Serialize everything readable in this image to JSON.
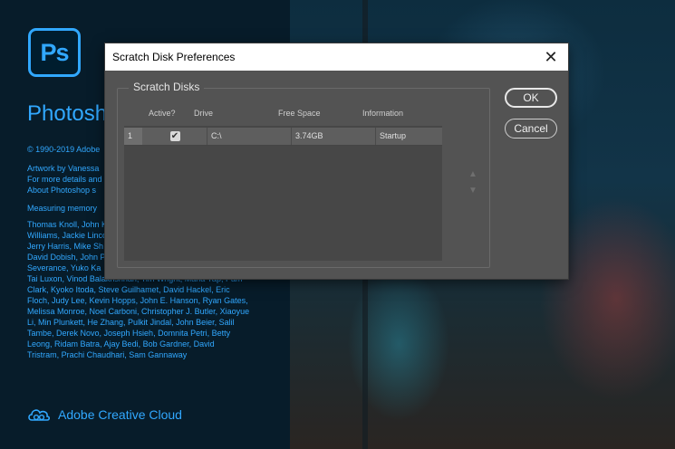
{
  "splash": {
    "logo_text": "Ps",
    "app_name": "Photoshop",
    "copyright": "© 1990-2019 Adobe",
    "artwork_lines": [
      "Artwork by Vanessa",
      "For more details and",
      "About Photoshop s"
    ],
    "measuring": "Measuring memory",
    "credits_top_lines": [
      "Thomas Knoll, John K",
      "Williams, Jackie Linco",
      "Jerry Harris, Mike Sh",
      "David Dobish, John P",
      "Severance, Yuko Ka"
    ],
    "credits_bottom_lines": [
      "Tai Luxon, Vinod Balakrishnan, Tim Wright, Maria Yap, Pam",
      "Clark, Kyoko Itoda, Steve Guilhamet, David Hackel, Eric",
      "Floch, Judy Lee, Kevin Hopps, John E. Hanson, Ryan Gates,",
      "Melissa Monroe, Noel Carboni, Christopher J. Butler, Xiaoyue",
      "Li, Min Plunkett, He Zhang, Pulkit Jindal, John Beier, Salil",
      "Tambe, Derek Novo, Joseph Hsieh, Domnita Petri, Betty",
      "Leong, Ridam Batra, Ajay Bedi, Bob Gardner, David",
      "Tristram, Prachi Chaudhari, Sam Gannaway"
    ],
    "cc_label": "Adobe Creative Cloud"
  },
  "dialog": {
    "title": "Scratch Disk Preferences",
    "close_glyph": "✕",
    "group_title": "Scratch Disks",
    "columns": {
      "active": "Active?",
      "drive": "Drive",
      "free_space": "Free Space",
      "information": "Information"
    },
    "rows": [
      {
        "num": "1",
        "active": true,
        "drive": "C:\\",
        "free_space": "3.74GB",
        "information": "Startup"
      }
    ],
    "check_glyph": "✔",
    "up_arrow": "▲",
    "down_arrow": "▼",
    "ok_label": "OK",
    "cancel_label": "Cancel"
  },
  "colors": {
    "accent": "#31a8ff",
    "dialog_bg": "#535353"
  }
}
